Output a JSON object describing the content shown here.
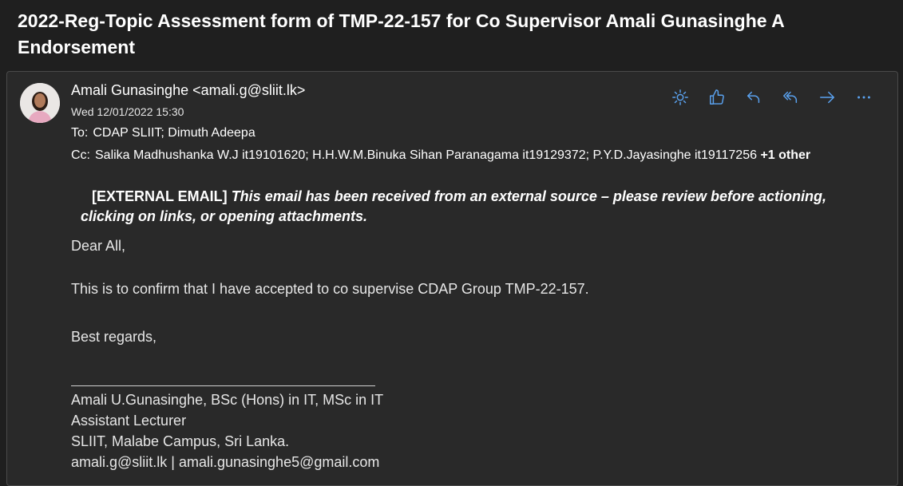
{
  "subject": "2022-Reg-Topic Assessment form of TMP-22-157 for Co Supervisor Amali Gunasinghe A Endorsement",
  "sender": {
    "display": "Amali Gunasinghe <amali.g@sliit.lk>",
    "date": "Wed 12/01/2022 15:30"
  },
  "recipients": {
    "to_label": "To:",
    "to": "CDAP SLIIT; Dimuth Adeepa",
    "cc_label": "Cc:",
    "cc": "Salika Madhushanka W.J it19101620; H.H.W.M.Binuka Sihan Paranagama it19129372; P.Y.D.Jayasinghe it19117256 ",
    "cc_more": "+1 other"
  },
  "toolbar": {
    "icons": [
      "sun-icon",
      "thumbs-up-icon",
      "reply-icon",
      "reply-all-icon",
      "forward-icon",
      "more-icon"
    ]
  },
  "banner": {
    "tag": "[EXTERNAL EMAIL]",
    "message": "This email has been received from an external source – please review before actioning, clicking on links, or opening attachments."
  },
  "body": {
    "greeting": "Dear All,",
    "message": "This is to confirm that I have accepted to co supervise CDAP Group  TMP-22-157.",
    "closing": "Best regards,"
  },
  "signature": {
    "line1": "Amali U.Gunasinghe, BSc (Hons) in IT, MSc in IT",
    "line2": "Assistant Lecturer",
    "line3": "SLIIT, Malabe Campus, Sri Lanka.",
    "line4": "amali.g@sliit.lk | amali.gunasinghe5@gmail.com"
  },
  "colors": {
    "background": "#1f1f1f",
    "card": "#292929",
    "accent": "#5aa2f0"
  }
}
